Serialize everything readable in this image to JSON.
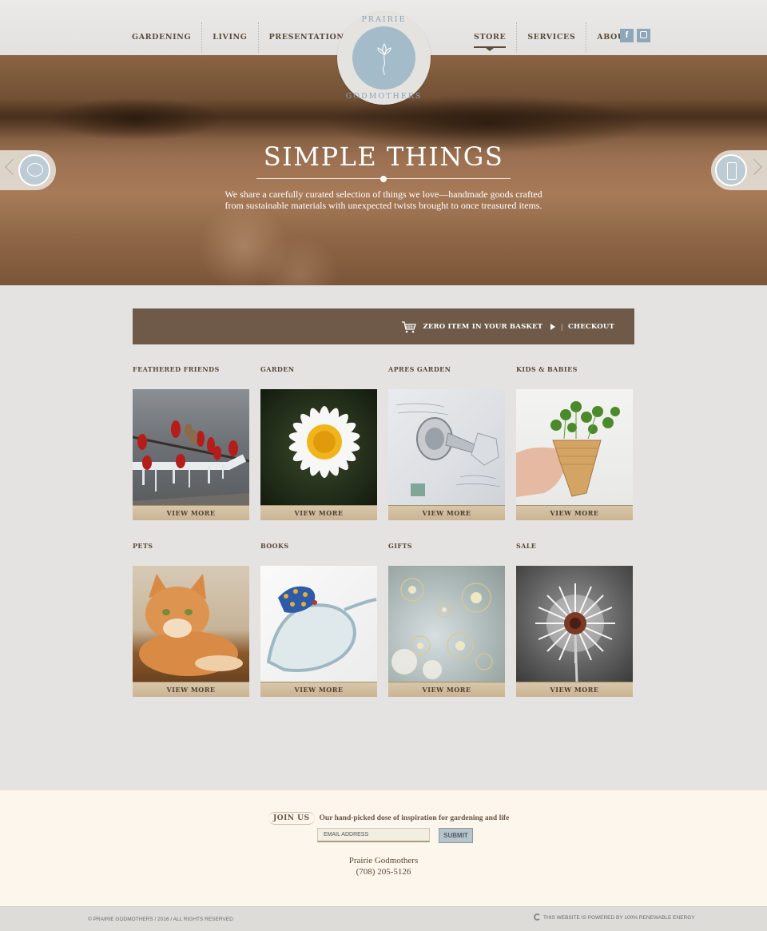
{
  "nav": {
    "left": [
      "GARDENING",
      "LIVING",
      "PRESENTATIONS"
    ],
    "right": [
      "STORE",
      "SERVICES",
      "ABOUT"
    ],
    "active": "STORE",
    "social": [
      {
        "icon": "facebook-icon",
        "glyph": "f"
      },
      {
        "icon": "instagram-icon",
        "glyph": ""
      }
    ]
  },
  "logo": {
    "top_text": "PRAIRIE",
    "bottom_text": "GODMOTHERS",
    "color": "#a4bcc9"
  },
  "hero": {
    "title": "SIMPLE THINGS",
    "text": "We share a carefully curated selection of things we love—handmade goods crafted from sustainable materials with unexpected twists brought to once treasured items.",
    "left_icon": "speech-bubble-icon",
    "right_icon": "phone-icon"
  },
  "basket": {
    "text": "ZERO ITEM IN YOUR BASKET",
    "separator": "|",
    "checkout": "CHECKOUT",
    "bg": "#6f5a49"
  },
  "categories": [
    {
      "label": "FEATHERED FRIENDS",
      "button": "VIEW MORE"
    },
    {
      "label": "GARDEN",
      "button": "VIEW MORE"
    },
    {
      "label": "APRES GARDEN",
      "button": "VIEW MORE"
    },
    {
      "label": "KIDS & BABIES",
      "button": "VIEW MORE"
    },
    {
      "label": "PETS",
      "button": "VIEW MORE"
    },
    {
      "label": "BOOKS",
      "button": "VIEW MORE"
    },
    {
      "label": "GIFTS",
      "button": "VIEW MORE"
    },
    {
      "label": "SALE",
      "button": "VIEW MORE"
    }
  ],
  "newsletter": {
    "badge": "JOIN US",
    "text": "Our hand-picked dose of inspiration for gardening and life",
    "placeholder": "EMAIL ADDRESS",
    "submit": "SUBMIT"
  },
  "contact": {
    "name": "Prairie Godmothers",
    "phone": "(708) 205-5126"
  },
  "footer": {
    "copyright": "© PRAIRIE GODMOTHERS / 2016 / ALL RIGHTS RESERVED",
    "energy": "THIS WEBSITE IS POWERED BY 100% RENEWABLE ENERGY"
  }
}
